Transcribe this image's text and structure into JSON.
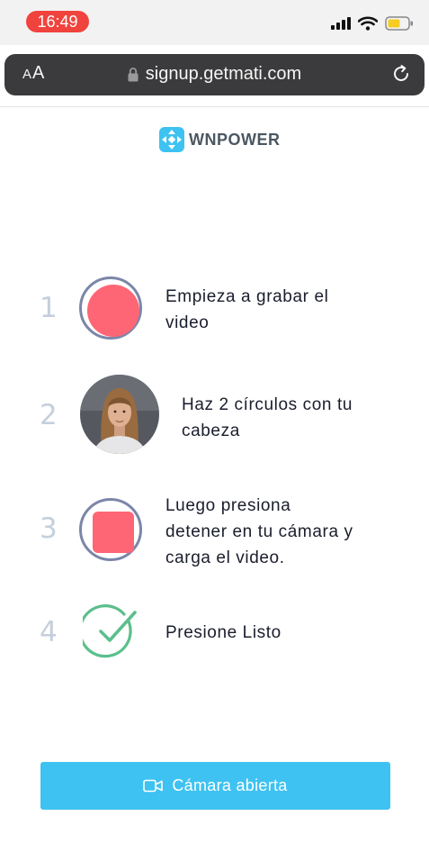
{
  "status_bar": {
    "time": "16:49",
    "icons": [
      "signal-icon",
      "wifi-icon",
      "battery-icon"
    ],
    "time_pill_color": "#f1433d"
  },
  "browser": {
    "text_size_label_small": "A",
    "text_size_label_large": "A",
    "url": "signup.getmati.com",
    "lock_icon": "lock-icon",
    "reload_icon": "reload-icon"
  },
  "logo": {
    "text": "WNPOWER",
    "icon": "wnpower-logo-icon",
    "color": "#3ec2f1"
  },
  "steps": [
    {
      "number": "1",
      "lines": [
        "Empieza a grabar el",
        "video"
      ],
      "icon": "record-button-icon"
    },
    {
      "number": "2",
      "lines": [
        "Haz 2 círculos con tu",
        "cabeza"
      ],
      "icon": "person-avatar"
    },
    {
      "number": "3",
      "lines": [
        "Luego presiona",
        "detener en tu cámara y",
        "carga el video."
      ],
      "icon": "stop-button-icon"
    },
    {
      "number": "4",
      "lines": [
        "Presione Listo"
      ],
      "icon": "checkmark-icon"
    }
  ],
  "cta": {
    "label": "Cámara abierta",
    "icon": "video-camera-icon",
    "color": "#3ec2f1"
  },
  "colors": {
    "record_red": "#fe6675",
    "ring_gray": "#7b86a8",
    "check_green": "#5bbf8c",
    "step_number_gray": "#c5cfdc"
  }
}
